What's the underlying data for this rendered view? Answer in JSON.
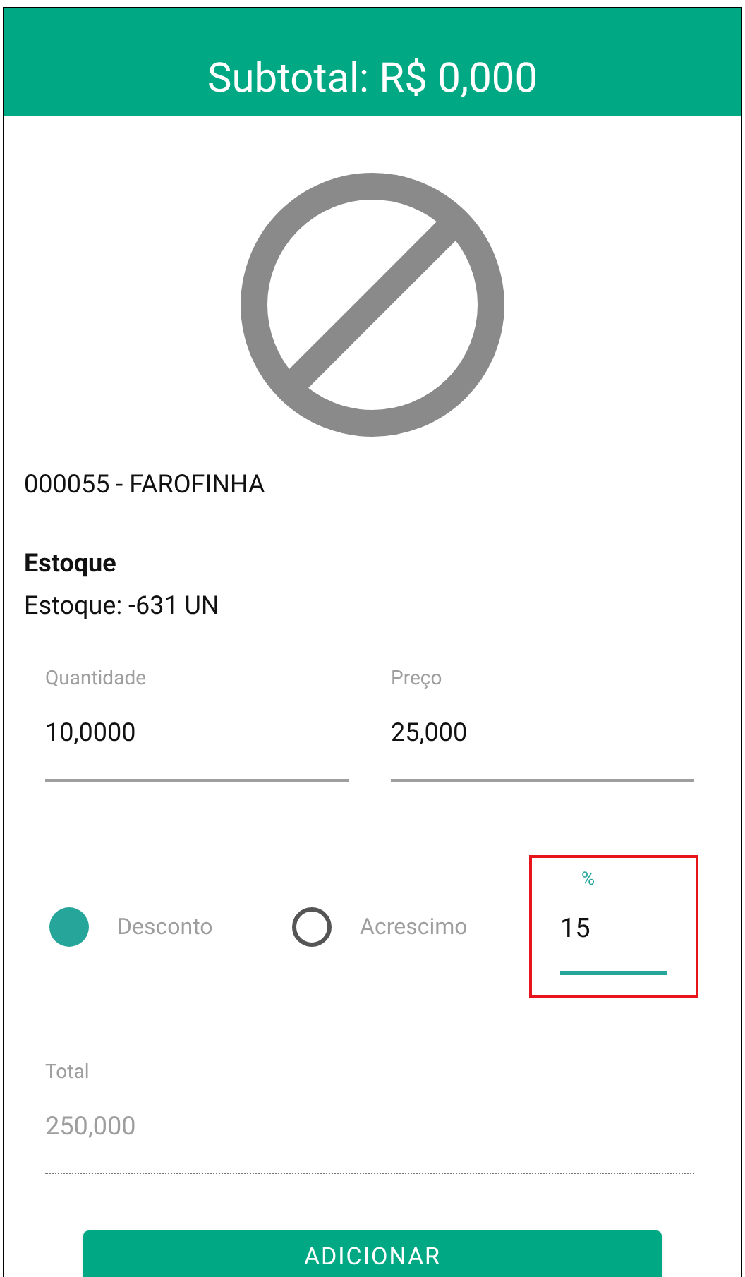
{
  "header": {
    "title": "Subtotal: R$ 0,000"
  },
  "product": {
    "name": "000055 - FAROFINHA",
    "stock_heading": "Estoque",
    "stock": "Estoque: -631 UN"
  },
  "fields": [
    {
      "label": "Quantidade",
      "value": "10,0000"
    },
    {
      "label": "Preço",
      "value": "25,000"
    }
  ],
  "adjustment_options": [
    {
      "label": "Desconto",
      "selected": true
    },
    {
      "label": "Acrescimo",
      "selected": false
    }
  ],
  "percent_field": {
    "label": "%",
    "value": "15",
    "focused": true,
    "highlighted": true
  },
  "total_field": {
    "label": "Total",
    "value": "250,000",
    "disabled": true
  },
  "button": {
    "label": "ADICIONAR"
  }
}
